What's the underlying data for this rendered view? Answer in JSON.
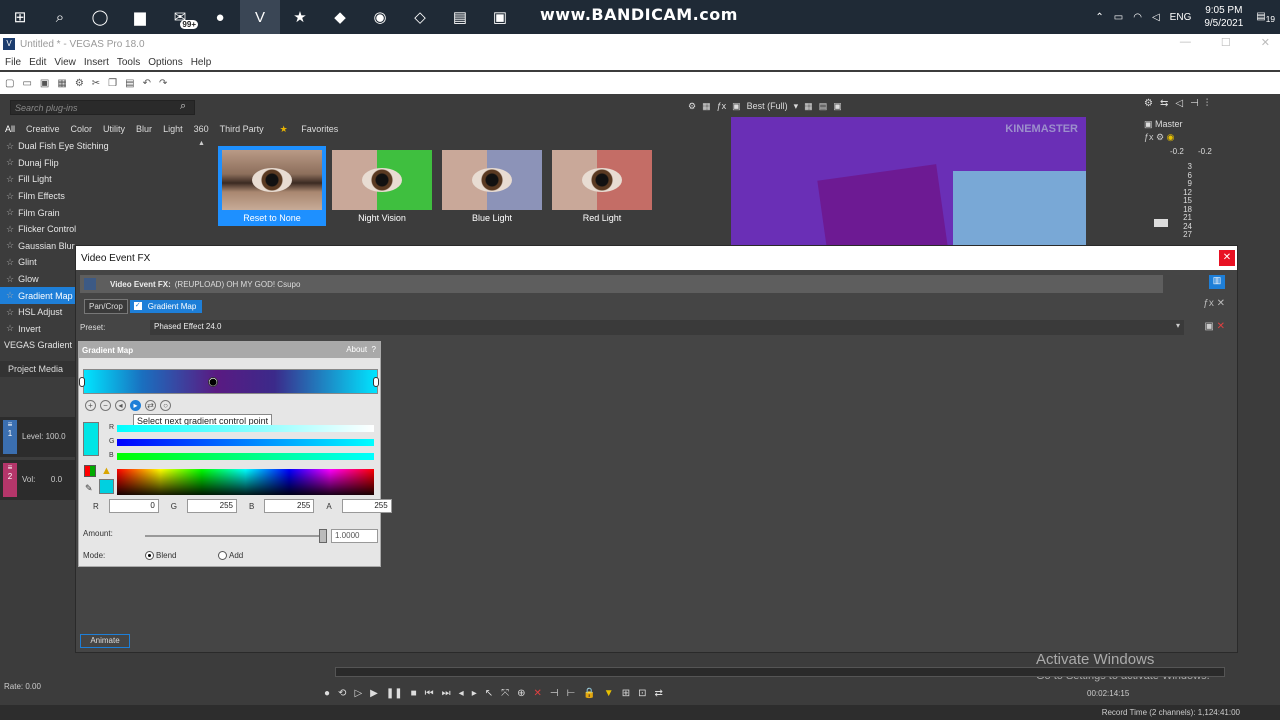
{
  "taskbar": {
    "badge": "99+",
    "watermark": "www.BANDICAM.com",
    "lang": "ENG",
    "time": "9:05 PM",
    "date": "9/5/2021",
    "notif_count": "19"
  },
  "window": {
    "title": "Untitled * - VEGAS Pro 18.0",
    "menu": [
      "File",
      "Edit",
      "View",
      "Insert",
      "Tools",
      "Options",
      "Help"
    ]
  },
  "plugins": {
    "search_placeholder": "Search plug-ins",
    "tabs": [
      "All",
      "Creative",
      "Color",
      "Utility",
      "Blur",
      "Light",
      "360",
      "Third Party",
      "Favorites"
    ],
    "items": [
      "Dual Fish Eye Stiching",
      "Dunaj Flip",
      "Fill Light",
      "Film Effects",
      "Film Grain",
      "Flicker Control",
      "Gaussian Blur",
      "Glint",
      "Glow",
      "Gradient Map",
      "HSL Adjust",
      "Invert"
    ],
    "footer": "VEGAS Gradient Map",
    "presets": [
      "Reset to None",
      "Night Vision",
      "Blue Light",
      "Red Light"
    ]
  },
  "preview": {
    "quality": "Best (Full)",
    "watermark": "KINEMASTER"
  },
  "master": {
    "label": "Master",
    "left_db": "-0.2",
    "right_db": "-0.2",
    "scale": [
      "3",
      "6",
      "9",
      "12",
      "15",
      "18",
      "21",
      "24",
      "27"
    ]
  },
  "vefx": {
    "window_title": "Video Event FX",
    "header_label": "Video Event FX:",
    "header_value": "(REUPLOAD) OH MY GOD! Csupo",
    "chain": [
      "Pan/Crop",
      "Gradient Map"
    ],
    "preset_label": "Preset:",
    "preset_value": "Phased Effect 24.0",
    "animate": "Animate"
  },
  "gradient_map": {
    "title": "Gradient Map",
    "about": "About",
    "about_q": "?",
    "tooltip": "Select next gradient control point",
    "rgb_labels": [
      "R",
      "G",
      "B"
    ],
    "r_label": "R",
    "r": "0",
    "g_label": "G",
    "g": "255",
    "b_label": "B",
    "b": "255",
    "a_label": "A",
    "a": "255",
    "amount_label": "Amount:",
    "amount": "1.0000",
    "mode_label": "Mode:",
    "mode_blend": "Blend",
    "mode_add": "Add"
  },
  "left": {
    "project_media": "Project Media",
    "level_label": "Level: 100.0",
    "vol_label": "Vol:",
    "vol_value": "0.0"
  },
  "bottom": {
    "rate": "Rate: 0.00",
    "timecode": "00:02:14:15",
    "activate_title": "Activate Windows",
    "activate_sub": "Go to Settings to activate Windows.",
    "record_time": "Record Time (2 channels): 1,124:41:00"
  }
}
